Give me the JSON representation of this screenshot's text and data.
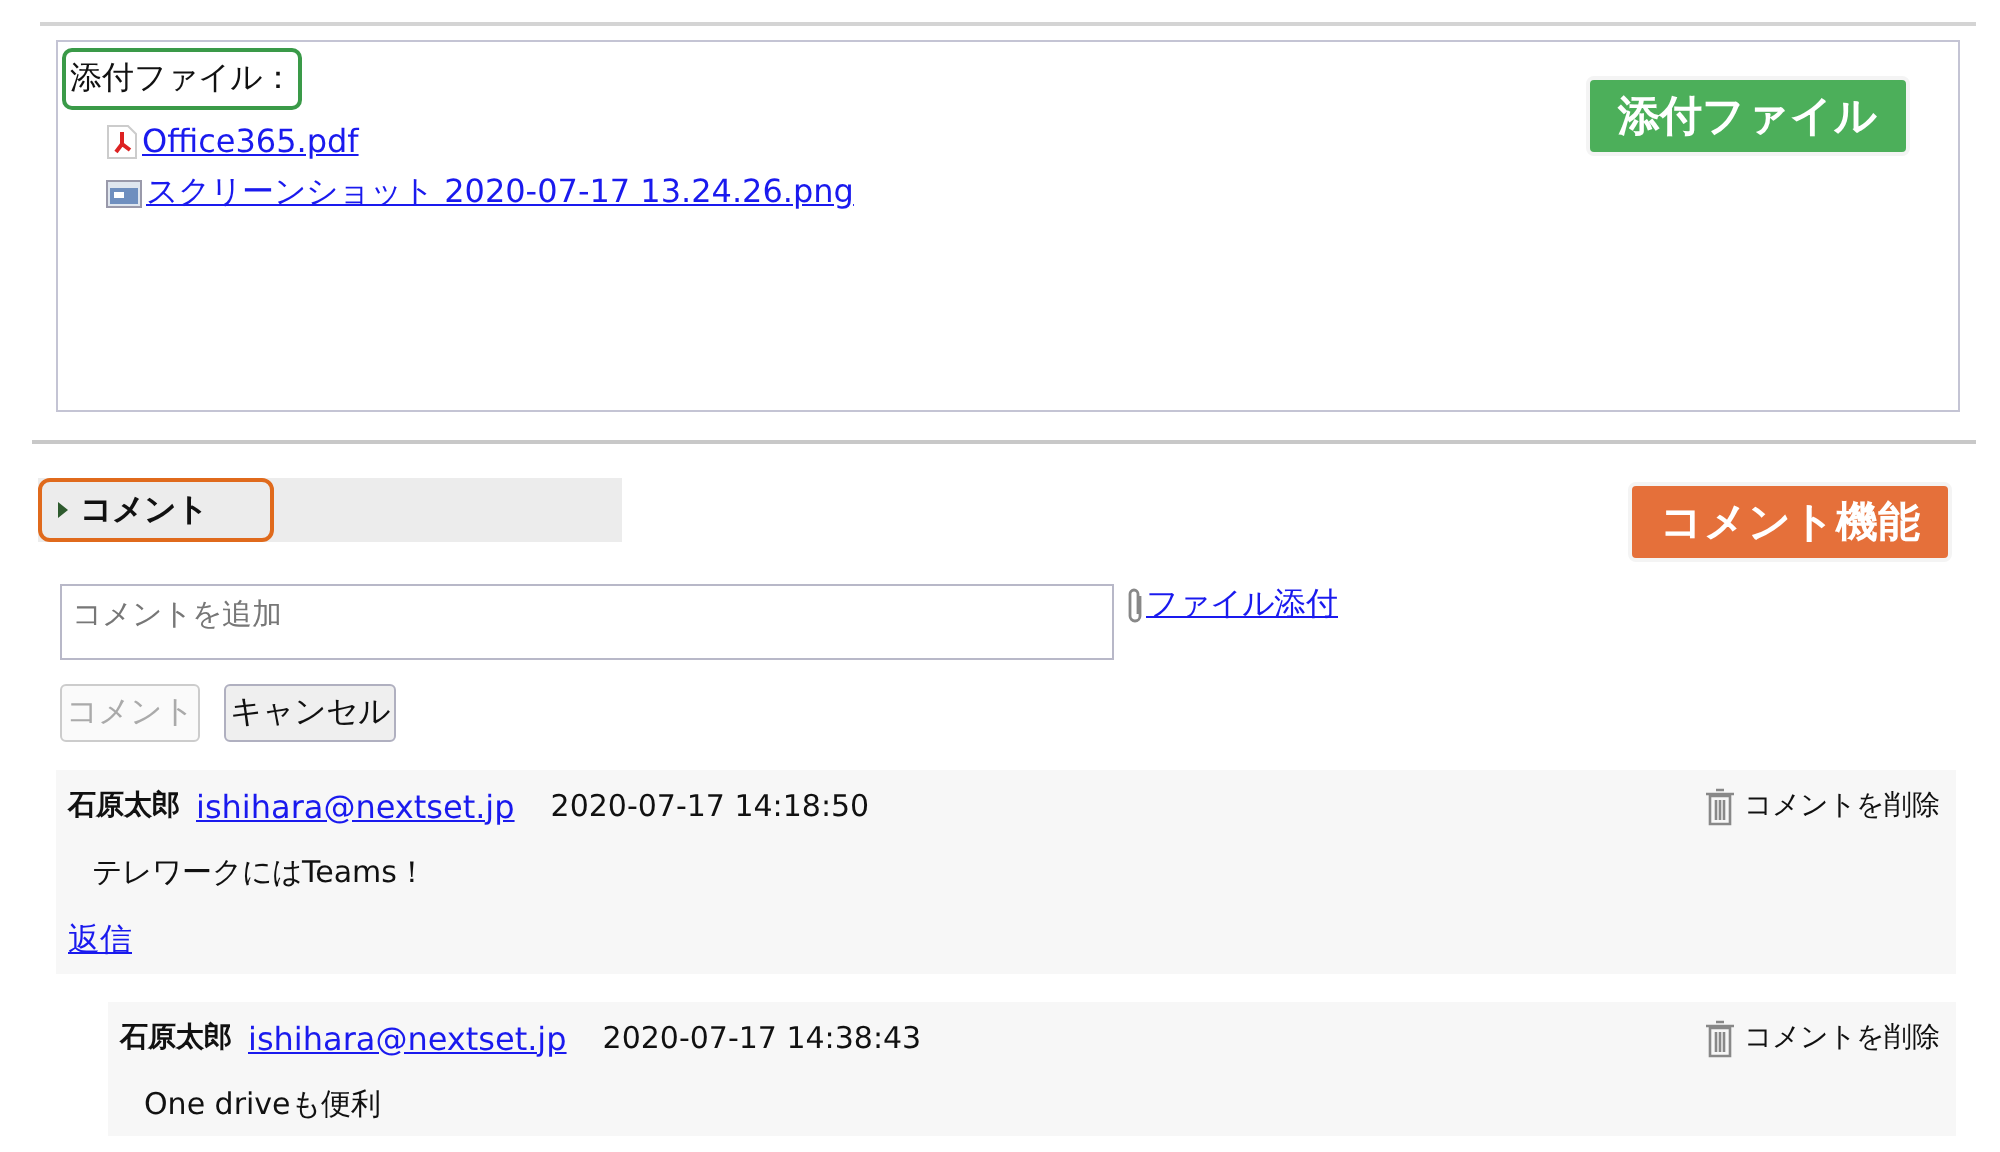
{
  "attachments": {
    "label": "添付ファイル：",
    "files": [
      {
        "kind": "pdf",
        "name": " Office365.pdf"
      },
      {
        "kind": "image",
        "name": " スクリーンショット 2020-07-17 13.24.26.png"
      }
    ],
    "callout": {
      "text": "添付ファイル",
      "color": "#4caf5a"
    }
  },
  "comments_section": {
    "title": "コメント",
    "callout": {
      "text": "コメント機能",
      "color": "#e5703a"
    },
    "input": {
      "placeholder": "コメントを追加"
    },
    "attach_link": "ファイル添付",
    "buttons": [
      {
        "label": "コメント",
        "disabled": true
      },
      {
        "label": "キャンセル",
        "disabled": false
      }
    ],
    "comments": [
      {
        "author": "石原太郎",
        "email": "ishihara@nextset.jp",
        "time": "2020-07-17 14:18:50",
        "delete": "コメントを削除",
        "body": "テレワークにはTeams！",
        "reply": "返信",
        "children": [
          {
            "author": "石原太郎",
            "email": "ishihara@nextset.jp",
            "time": "2020-07-17 14:38:43",
            "delete": "コメントを削除",
            "body": "One driveも便利"
          }
        ]
      }
    ]
  }
}
